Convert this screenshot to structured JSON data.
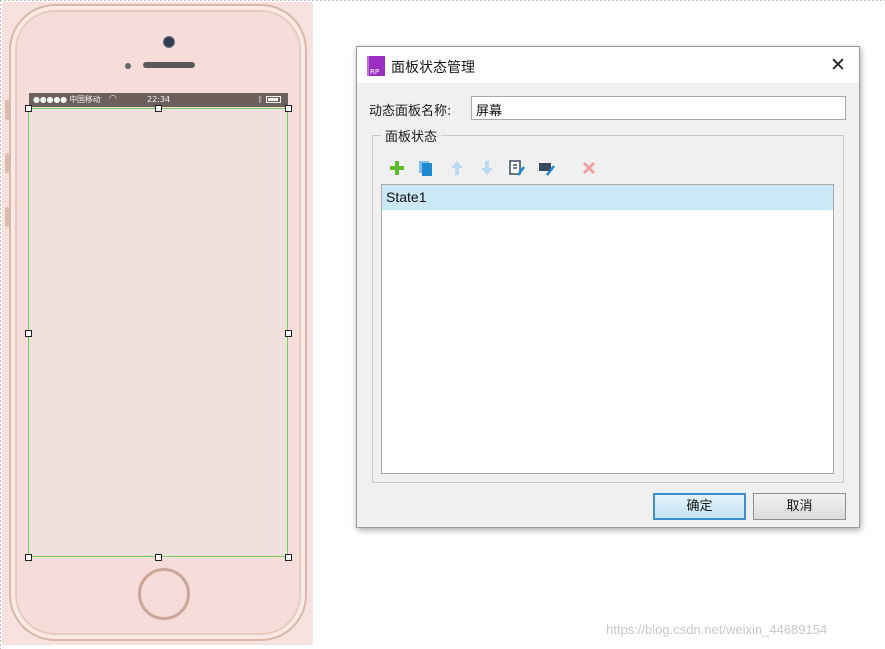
{
  "phone": {
    "carrier": "●●●●● 中国移动",
    "time": "22:34"
  },
  "dialog": {
    "title": "面板状态管理",
    "app_icon_text": "RP",
    "name_label": "动态面板名称:",
    "name_value": "屏幕",
    "group_label": "面板状态",
    "toolbar": [
      "add-icon",
      "duplicate-icon",
      "move-up-icon",
      "move-down-icon",
      "edit-state-icon",
      "edit-all-icon",
      "delete-icon"
    ],
    "states": [
      "State1"
    ],
    "selected_state": "State1",
    "ok_label": "确定",
    "cancel_label": "取消"
  },
  "watermark": "https://blog.csdn.net/weixin_44689154",
  "colors": {
    "accent": "#9a2fc2",
    "selection": "#cbe8f6",
    "add_green": "#5fb832",
    "copy_blue": "#1e88d0",
    "delete_red": "#f0a0a0"
  }
}
